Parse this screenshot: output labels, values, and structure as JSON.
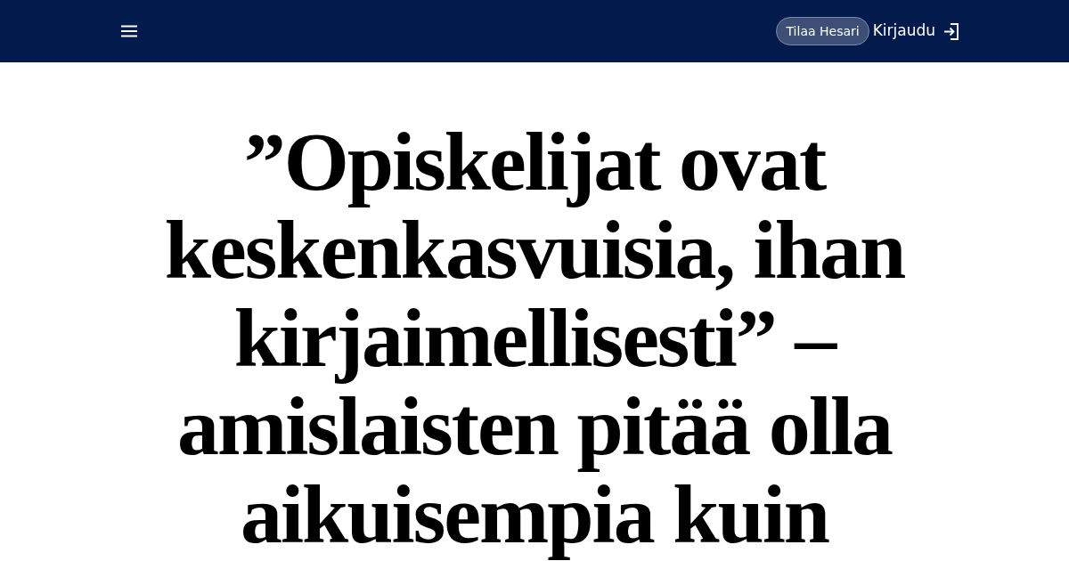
{
  "header": {
    "subscribe_button": "Tilaa Hesari",
    "login_link": "Kirjaudu"
  },
  "article": {
    "headline": "”Opiskelijat ovat keskenkasvuisia, ihan kirjaimellisesti” – amislaisten pitää olla aikuisempia kuin"
  }
}
